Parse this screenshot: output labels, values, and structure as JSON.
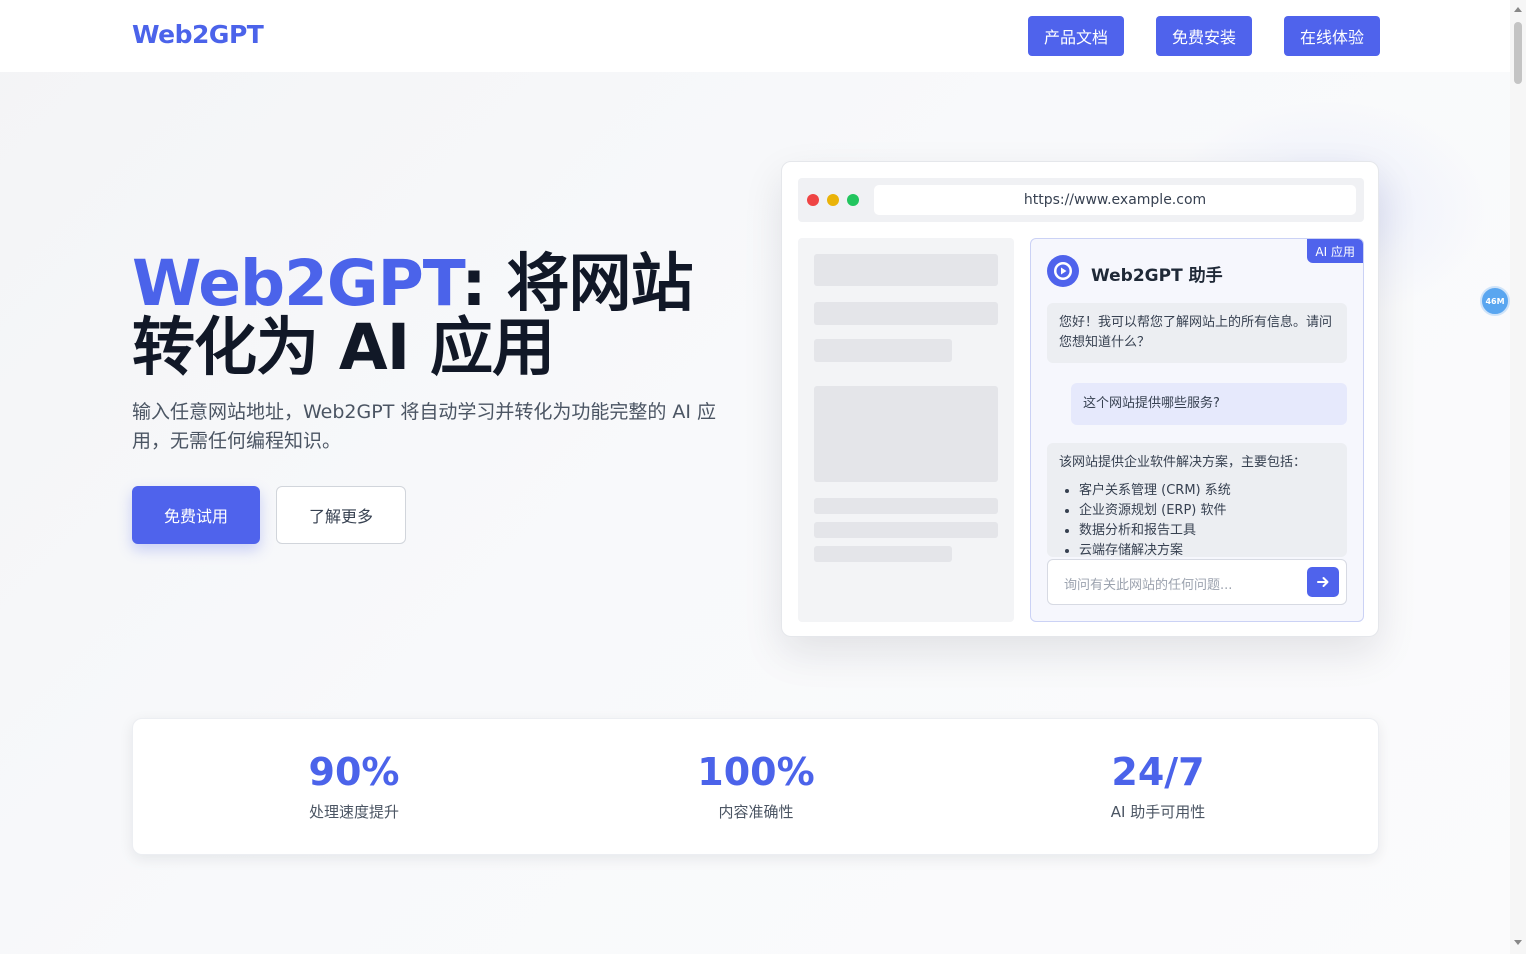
{
  "header": {
    "logo": "Web2GPT",
    "nav": {
      "docs": "产品文档",
      "install": "免费安装",
      "try_online": "在线体验"
    }
  },
  "hero": {
    "title_brand": "Web2GPT",
    "title_rest": ": 将网站转化为 AI 应用",
    "description": "输入任意网站地址，Web2GPT 将自动学习并转化为功能完整的 AI 应用，无需任何编程知识。",
    "primary_button": "免费试用",
    "secondary_button": "了解更多"
  },
  "mockup": {
    "url": "https://www.example.com",
    "badge": "AI 应用",
    "assistant_title": "Web2GPT 助手",
    "messages": {
      "greeting": "您好！我可以帮您了解网站上的所有信息。请问您想知道什么？",
      "user_question": "这个网站提供哪些服务?",
      "answer_intro": "该网站提供企业软件解决方案，主要包括：",
      "answer_items": [
        "客户关系管理 (CRM) 系统",
        "企业资源规划 (ERP) 软件",
        "数据分析和报告工具",
        "云端存储解决方案"
      ]
    },
    "input_placeholder": "询问有关此网站的任何问题...",
    "window_dot_colors": [
      "#ef4444",
      "#eab308",
      "#22c55e"
    ]
  },
  "stats": [
    {
      "value": "90%",
      "label": "处理速度提升"
    },
    {
      "value": "100%",
      "label": "内容准确性"
    },
    {
      "value": "24/7",
      "label": "AI 助手可用性"
    }
  ],
  "floating_badge": "46M",
  "colors": {
    "brand": "#4b63ea",
    "primary_button": "#4f63ec"
  }
}
